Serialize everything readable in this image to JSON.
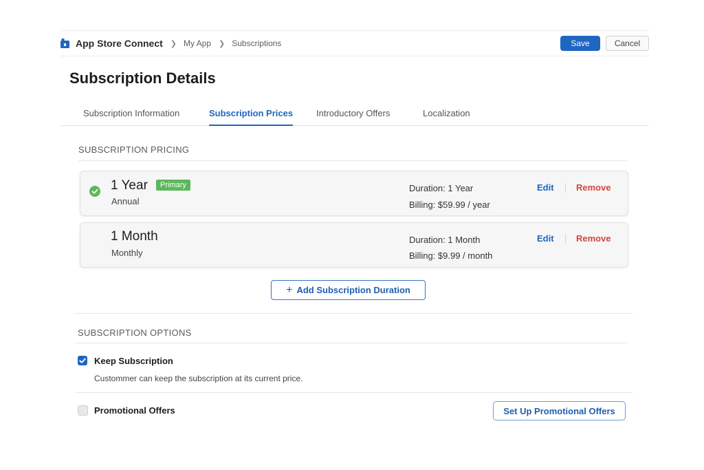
{
  "header": {
    "app_name": "App Store Connect",
    "breadcrumbs": [
      "My App",
      "Subscriptions"
    ],
    "save_label": "Save",
    "cancel_label": "Cancel"
  },
  "page": {
    "title": "Subscription Details"
  },
  "tabs": [
    {
      "label": "Subscription Information",
      "active": false
    },
    {
      "label": "Subscription Prices",
      "active": true
    },
    {
      "label": "Introductory Offers",
      "active": false
    },
    {
      "label": "Localization",
      "active": false
    }
  ],
  "pricing": {
    "section_label": "SUBSCRIPTION PRICING",
    "plans": [
      {
        "name": "1 Year",
        "subtitle": "Annual",
        "badge": "Primary",
        "duration": "Duration: 1 Year",
        "billing": "Billing: $59.99 / year",
        "edit_label": "Edit",
        "remove_label": "Remove"
      },
      {
        "name": "1 Month",
        "subtitle": "Monthly",
        "duration": "Duration: 1 Month",
        "billing": "Billing: $9.99 / month",
        "edit_label": "Edit",
        "remove_label": "Remove"
      }
    ],
    "add_label": "Add Subscription Duration"
  },
  "options": {
    "section_label": "SUBSCRIPTION OPTIONS",
    "keep": {
      "label": "Keep Subscription",
      "checked": true,
      "description": "Custommer can keep the subscription at its current price."
    },
    "promo": {
      "label": "Promotional Offers",
      "checked": false,
      "button_label": "Set Up Promotional Offers"
    }
  },
  "colors": {
    "accent": "#1f66c1",
    "badge_green": "#5cb85c",
    "remove_red": "#d1473f"
  }
}
